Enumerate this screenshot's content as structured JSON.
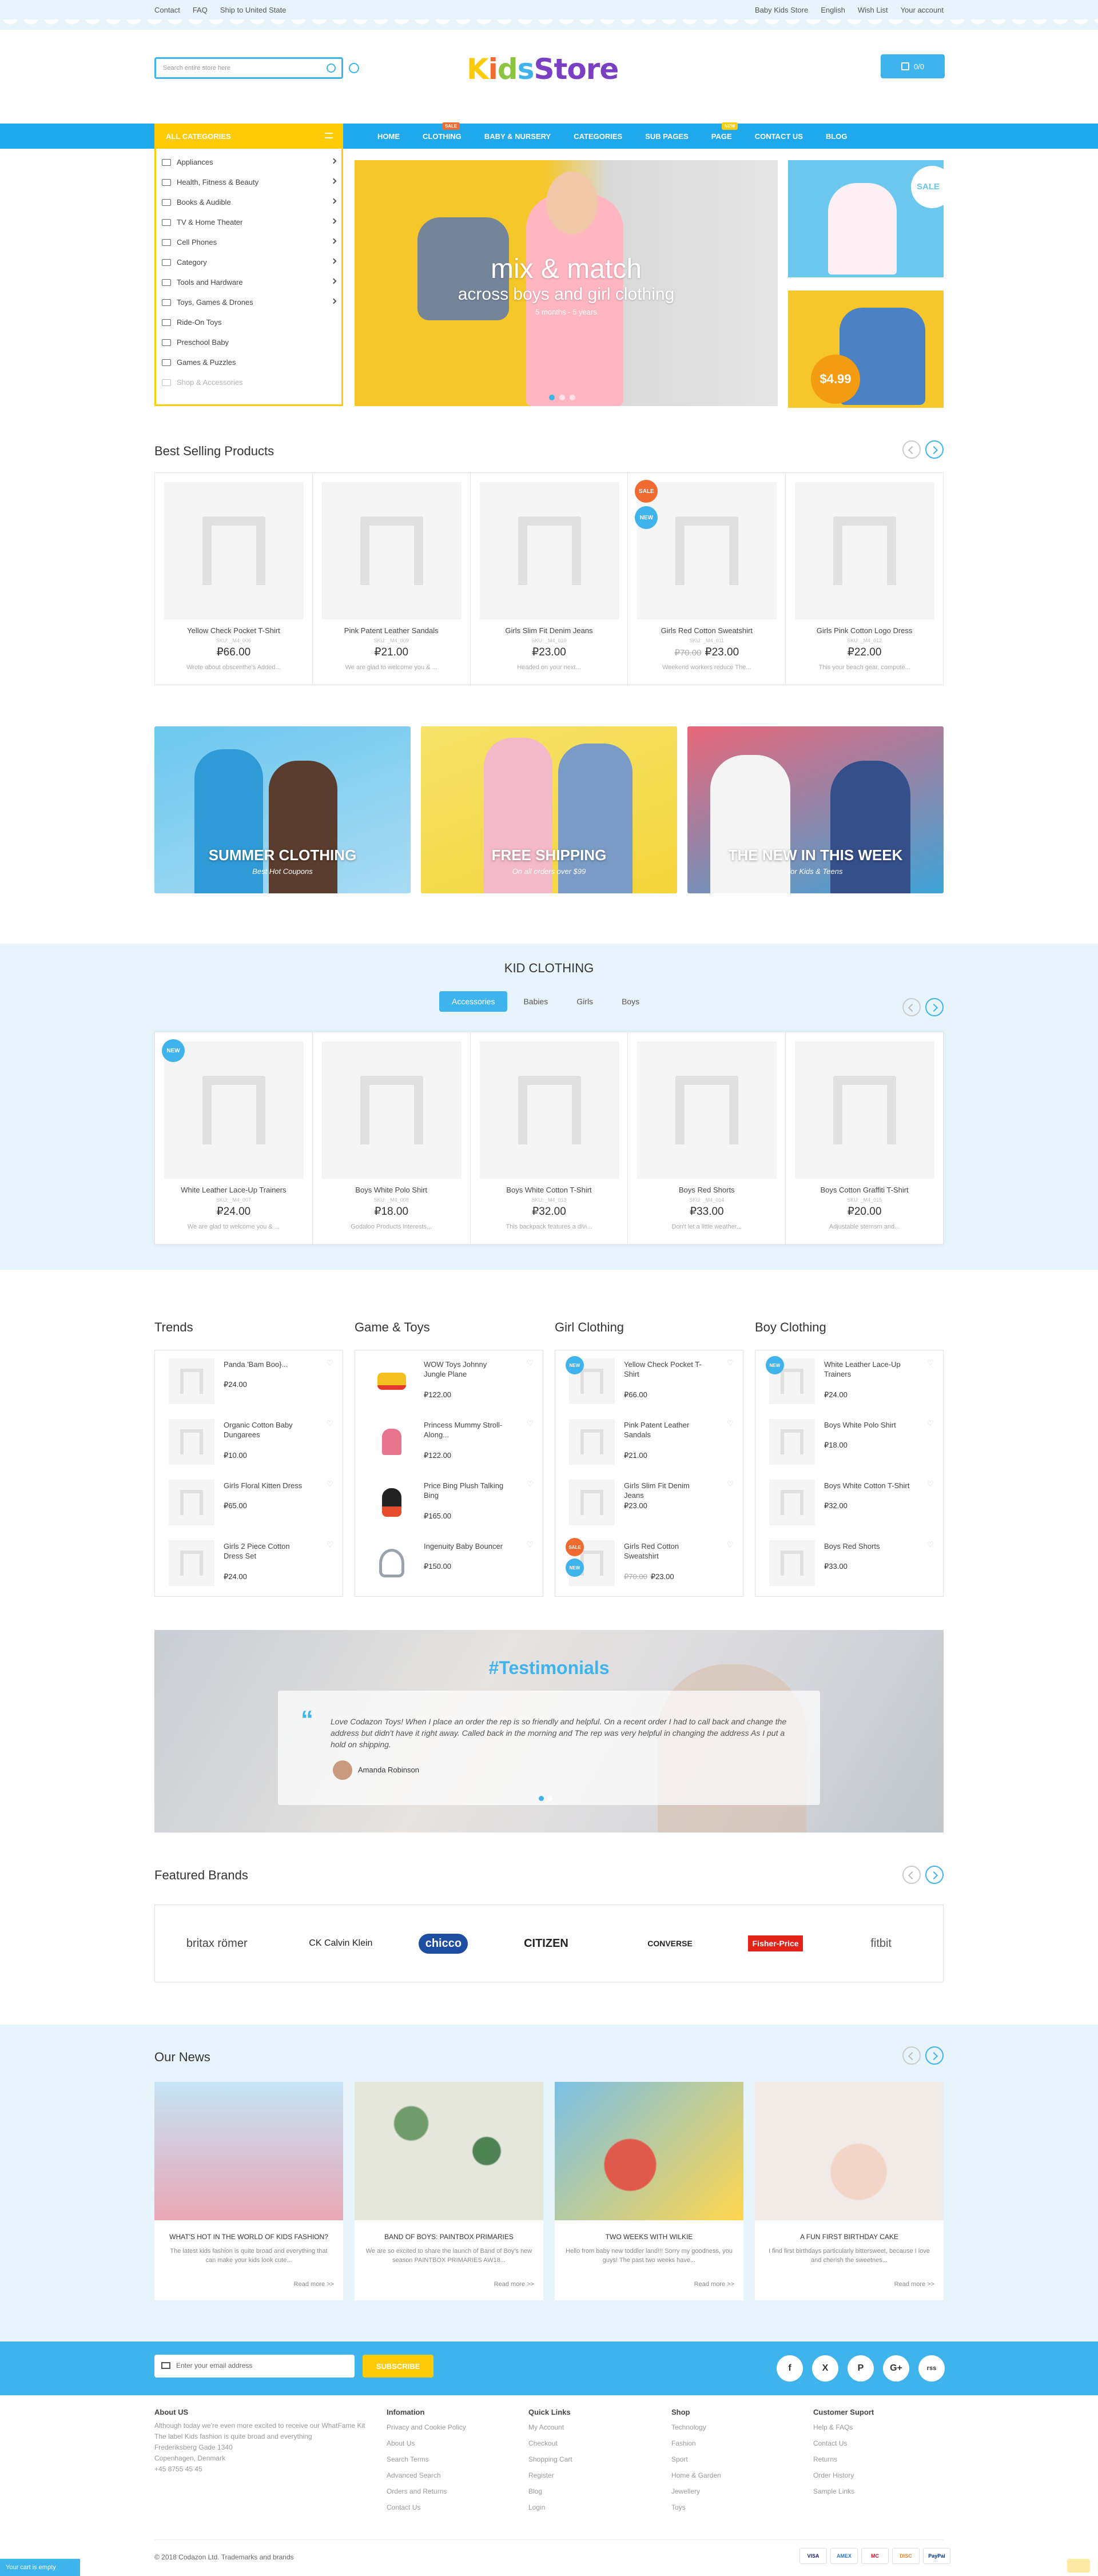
{
  "topbar": {
    "links": [
      "Contact",
      "FAQ",
      "Ship to United State"
    ],
    "store": "Baby Kids Store",
    "lang": "English",
    "wishlist": "Wish List",
    "account": "Your account"
  },
  "header": {
    "search_placeholder": "Search entire store here",
    "logo": "KidsStore",
    "cart_label": "0/0"
  },
  "nav": {
    "all_categories": "ALL CATEGORIES",
    "menu": [
      "HOME",
      "CLOTHING",
      "BABY & NURSERY",
      "CATEGORIES",
      "SUB PAGES",
      "PAGE",
      "CONTACT US",
      "BLOG"
    ],
    "badge_clothing": "SALE",
    "badge_page": "NEW"
  },
  "sidebar": {
    "items": [
      "Appliances",
      "Health, Fitness & Beauty",
      "Books & Audible",
      "TV & Home Theater",
      "Cell Phones",
      "Category",
      "Tools and Hardware",
      "Toys, Games & Drones",
      "Ride-On Toys",
      "Preschool Baby",
      "Games & Puzzles",
      "Shop & Accessories"
    ]
  },
  "hero": {
    "title": "mix & match",
    "subtitle": "across boys and girl clothing",
    "note": "5 months - 5 years"
  },
  "promo": {
    "sale": "SALE",
    "price": "$4.99"
  },
  "best_selling": {
    "title": "Best Selling Products",
    "products": [
      {
        "name": "Yellow Check Pocket T-Shirt",
        "sku": "SKU: _M4_006",
        "price": "₽66.00",
        "old": "",
        "desc": "Wrote about obscenthe's Added..."
      },
      {
        "name": "Pink Patent Leather Sandals",
        "sku": "SKU: _M4_009",
        "price": "₽21.00",
        "old": "",
        "desc": "We are glad to welcome you & ..."
      },
      {
        "name": "Girls Slim Fit Denim Jeans",
        "sku": "SKU: _M4_010",
        "price": "₽23.00",
        "old": "",
        "desc": "Headed on your next..."
      },
      {
        "name": "Girls Red Cotton Sweatshirt",
        "sku": "SKU: _M4_011",
        "price": "₽23.00",
        "old": "₽70.00",
        "desc": "Weekend workers reduce The..."
      },
      {
        "name": "Girls Pink Cotton Logo Dress",
        "sku": "SKU: _M4_012",
        "price": "₽22.00",
        "old": "",
        "desc": "This your beach gear, compute..."
      }
    ]
  },
  "banners": [
    {
      "title": "SUMMER CLOTHING",
      "sub": "Best Hot Coupons"
    },
    {
      "title": "FREE SHIPPING",
      "sub": "On all orders over $99"
    },
    {
      "title": "THE NEW IN THIS WEEK",
      "sub": "for Kids & Teens"
    }
  ],
  "kid_clothing": {
    "title": "KID CLOTHING",
    "tabs": [
      "Accessories",
      "Babies",
      "Girls",
      "Boys"
    ],
    "products": [
      {
        "name": "White Leather Lace-Up Trainers",
        "sku": "SKU: _M4_007",
        "price": "₽24.00",
        "old": "",
        "desc": "We are glad to welcome you & ..."
      },
      {
        "name": "Boys White Polo Shirt",
        "sku": "SKU: _M4_008",
        "price": "₽18.00",
        "old": "",
        "desc": "Godaloo Products interests..."
      },
      {
        "name": "Boys White Cotton T-Shirt",
        "sku": "SKU: _M4_013",
        "price": "₽32.00",
        "old": "",
        "desc": "This backpack features a divi..."
      },
      {
        "name": "Boys Red Shorts",
        "sku": "SKU: _M4_014",
        "price": "₽33.00",
        "old": "",
        "desc": "Don't let a little weather..."
      },
      {
        "name": "Boys Cotton Graffiti T-Shirt",
        "sku": "SKU: _M4_015",
        "price": "₽20.00",
        "old": "",
        "desc": "Adjustable stemsm and..."
      }
    ]
  },
  "lists": [
    {
      "title": "Trends",
      "items": [
        {
          "name": "Panda 'Bam Boo}...",
          "price": "₽24.00",
          "old": ""
        },
        {
          "name": "Organic Cotton Baby Dungarees",
          "price": "₽10.00",
          "old": ""
        },
        {
          "name": "Girls Floral Kitten Dress",
          "price": "₽65.00",
          "old": ""
        },
        {
          "name": "Girls 2 Piece Cotton Dress Set",
          "price": "₽24.00",
          "old": ""
        }
      ]
    },
    {
      "title": "Game & Toys",
      "items": [
        {
          "name": "WOW Toys Johnny Jungle Plane",
          "price": "₽122.00",
          "old": ""
        },
        {
          "name": "Princess Mummy Stroll-Along...",
          "price": "₽122.00",
          "old": ""
        },
        {
          "name": "Price Bing Plush Talking Bing",
          "price": "₽165.00",
          "old": ""
        },
        {
          "name": "Ingenuity Baby Bouncer",
          "price": "₽150.00",
          "old": ""
        }
      ]
    },
    {
      "title": "Girl Clothing",
      "items": [
        {
          "name": "Yellow Check Pocket T-Shirt",
          "price": "₽66.00",
          "old": ""
        },
        {
          "name": "Pink Patent Leather Sandals",
          "price": "₽21.00",
          "old": ""
        },
        {
          "name": "Girls Slim Fit Denim Jeans",
          "price": "₽23.00",
          "old": ""
        },
        {
          "name": "Girls Red Cotton Sweatshirt",
          "price": "₽23.00",
          "old": "₽70.00"
        }
      ]
    },
    {
      "title": "Boy Clothing",
      "items": [
        {
          "name": "White Leather Lace-Up Trainers",
          "price": "₽24.00",
          "old": ""
        },
        {
          "name": "Boys White Polo Shirt",
          "price": "₽18.00",
          "old": ""
        },
        {
          "name": "Boys White Cotton T-Shirt",
          "price": "₽32.00",
          "old": ""
        },
        {
          "name": "Boys Red Shorts",
          "price": "₽33.00",
          "old": ""
        }
      ]
    }
  ],
  "testimonials": {
    "title": "#Testimonials",
    "text": "Love Codazon Toys! When I place an order the rep is so friendly and helpful. On a recent order I had to call back and change the address but didn't have it right away. Called back in the morning and The rep was very helpful in changing the address As I put a hold on shipping.",
    "author": "Amanda Robinson"
  },
  "brands": {
    "title": "Featured Brands",
    "items": [
      "britax römer",
      "CK Calvin Klein",
      "chicco",
      "CITIZEN",
      "CONVERSE",
      "Fisher-Price",
      "fitbit"
    ]
  },
  "news": {
    "title": "Our News",
    "items": [
      {
        "title": "WHAT'S HOT IN THE WORLD OF KIDS FASHION?",
        "desc": "The latest kids fashion is quite broad and everything that can make your kids look cute...",
        "more": "Read more >>"
      },
      {
        "title": "BAND OF BOYS: PAINTBOX PRIMARIES",
        "desc": "We are so excited to share the launch of Band of Boy's new season PAINTBOX PRIMARIES AW18...",
        "more": "Read more >>"
      },
      {
        "title": "TWO WEEKS WITH WILKIE",
        "desc": "Hello from baby new toddler land!!! Sorry my goodness, you guys! The past two weeks have...",
        "more": "Read more >>"
      },
      {
        "title": "A FUN FIRST BIRTHDAY CAKE",
        "desc": "I find first birthdays particularly bittersweet, because I love and cherish the sweetnes...",
        "more": "Read more >>"
      }
    ]
  },
  "newsletter": {
    "placeholder": "Enter your email address",
    "button": "SUBSCRIBE",
    "social": [
      "f",
      "X",
      "P",
      "G+",
      "rss"
    ]
  },
  "footer": {
    "about": {
      "title": "About US",
      "lines": [
        "Although today we're even more excited to receive our WhatFame Kit",
        "The label Kids fashion is quite broad and everything",
        "Frederiksberg Gade 1340",
        "Copenhagen, Denmark",
        "+45 8755 45 45"
      ]
    },
    "info": {
      "title": "Infomation",
      "links": [
        "Privacy and Cookie Policy",
        "About Us",
        "Search Terms",
        "Advanced Search",
        "Orders and Returns",
        "Contact Us"
      ]
    },
    "quick": {
      "title": "Quick Links",
      "links": [
        "My Account",
        "Checkout",
        "Shopping Cart",
        "Register",
        "Blog",
        "Login"
      ]
    },
    "shop": {
      "title": "Shop",
      "links": [
        "Technology",
        "Fashion",
        "Sport",
        "Home & Garden",
        "Jewellery",
        "Toys"
      ]
    },
    "support": {
      "title": "Customer Suport",
      "links": [
        "Help & FAQs",
        "Contact Us",
        "Returns",
        "Order History",
        "Sample Links"
      ]
    },
    "copyright": "© 2018 Codazon Ltd. Trademarks and brands",
    "payments": [
      "VISA",
      "AMEX",
      "MC",
      "DISC",
      "PayPal"
    ],
    "cart_msg": "Your cart is empty"
  },
  "colors": {
    "accent": "#3fb3ec",
    "yellow": "#ffcb05",
    "sale": "#f16a2f",
    "light_bg": "#e7f4fb"
  }
}
